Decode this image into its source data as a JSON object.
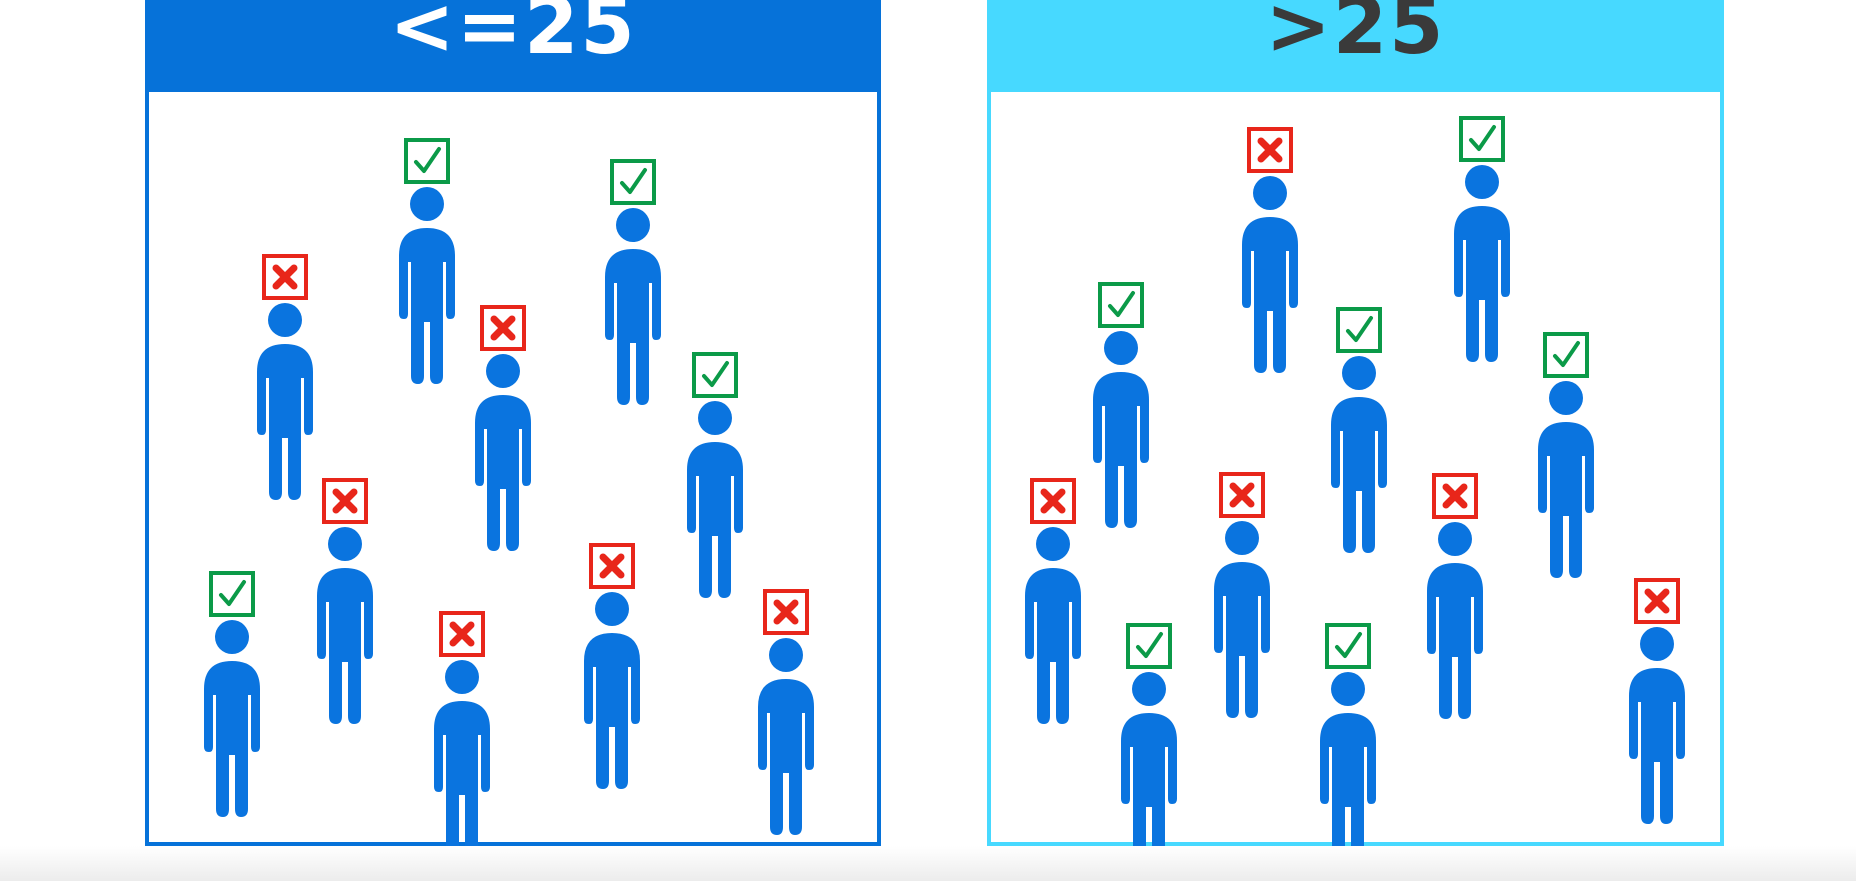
{
  "groups": [
    {
      "label": "<=25",
      "color": "#0672d9",
      "people": [
        {
          "outcome": "yes"
        },
        {
          "outcome": "no"
        },
        {
          "outcome": "yes"
        },
        {
          "outcome": "no"
        },
        {
          "outcome": "yes"
        },
        {
          "outcome": "no"
        },
        {
          "outcome": "yes"
        },
        {
          "outcome": "no"
        },
        {
          "outcome": "no"
        },
        {
          "outcome": "no"
        }
      ]
    },
    {
      "label": ">25",
      "color": "#47d9ff",
      "people": [
        {
          "outcome": "no"
        },
        {
          "outcome": "yes"
        },
        {
          "outcome": "yes"
        },
        {
          "outcome": "yes"
        },
        {
          "outcome": "yes"
        },
        {
          "outcome": "no"
        },
        {
          "outcome": "no"
        },
        {
          "outcome": "no"
        },
        {
          "outcome": "yes"
        },
        {
          "outcome": "yes"
        },
        {
          "outcome": "no"
        }
      ]
    }
  ],
  "colors": {
    "person": "#0a74df",
    "yes_mark": "#0b9a48",
    "no_mark": "#e8261a"
  },
  "icons": {
    "person": "person-icon",
    "yes": "check-box-icon",
    "no": "x-box-icon"
  }
}
